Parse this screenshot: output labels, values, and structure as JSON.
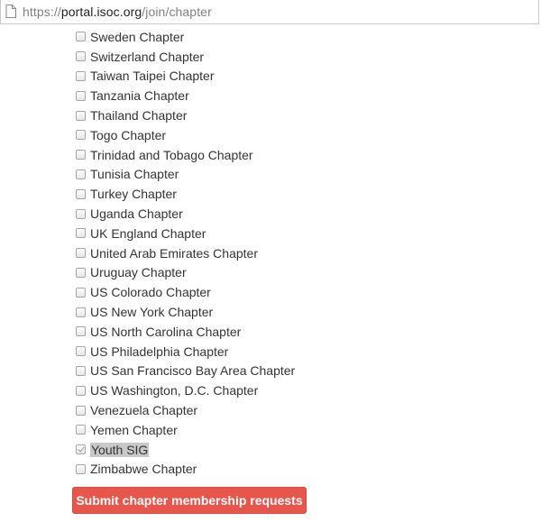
{
  "address_bar": {
    "url_protocol": "https://",
    "url_domain": "portal.isoc.org",
    "url_path": "/join/chapter",
    "page_icon": "page-icon"
  },
  "chapters": [
    {
      "label": "Sweden Chapter",
      "checked": false
    },
    {
      "label": "Switzerland Chapter",
      "checked": false
    },
    {
      "label": "Taiwan Taipei Chapter",
      "checked": false
    },
    {
      "label": "Tanzania Chapter",
      "checked": false
    },
    {
      "label": "Thailand Chapter",
      "checked": false
    },
    {
      "label": "Togo Chapter",
      "checked": false
    },
    {
      "label": "Trinidad and Tobago Chapter",
      "checked": false
    },
    {
      "label": "Tunisia Chapter",
      "checked": false
    },
    {
      "label": "Turkey Chapter",
      "checked": false
    },
    {
      "label": "Uganda Chapter",
      "checked": false
    },
    {
      "label": "UK England Chapter",
      "checked": false
    },
    {
      "label": "United Arab Emirates Chapter",
      "checked": false
    },
    {
      "label": "Uruguay Chapter",
      "checked": false
    },
    {
      "label": "US Colorado Chapter",
      "checked": false
    },
    {
      "label": "US New York Chapter",
      "checked": false
    },
    {
      "label": "US North Carolina Chapter",
      "checked": false
    },
    {
      "label": "US Philadelphia Chapter",
      "checked": false
    },
    {
      "label": "US San Francisco Bay Area Chapter",
      "checked": false
    },
    {
      "label": "US Washington, D.C. Chapter",
      "checked": false
    },
    {
      "label": "Venezuela Chapter",
      "checked": false
    },
    {
      "label": "Yemen Chapter",
      "checked": false
    },
    {
      "label": "Youth SIG",
      "checked": true,
      "selected": true
    },
    {
      "label": "Zimbabwe Chapter",
      "checked": false
    }
  ],
  "submit_button": {
    "label": "Submit chapter membership requests",
    "color": "#e8554a"
  }
}
